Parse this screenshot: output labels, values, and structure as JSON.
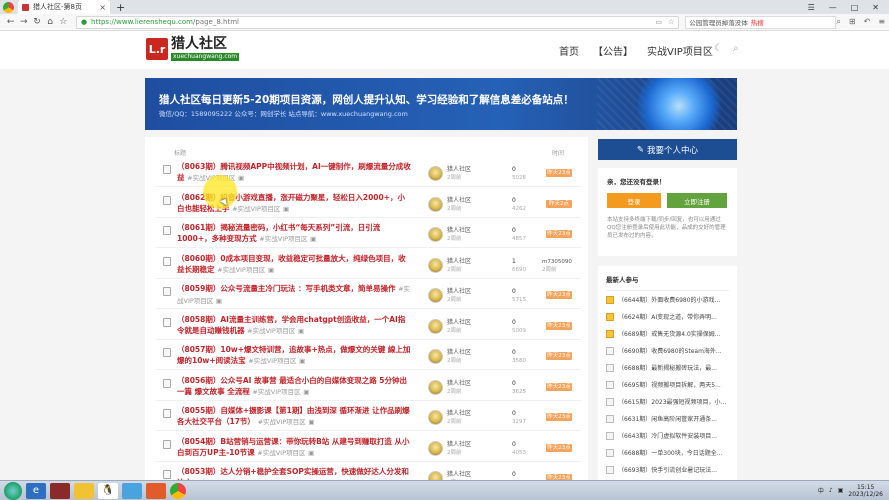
{
  "browser": {
    "tab_title": "猎人社区-第8页",
    "url_host": "https://www.lierenshequ.com",
    "url_path": "/page_8.html",
    "search_text": "公园管理员掉落没体",
    "search_hot": "热搜"
  },
  "site": {
    "logo_badge": "L.r",
    "logo_name": "猎人社区",
    "logo_sub": "xuechuangwang.com",
    "nav": [
      "首页",
      "【公告】",
      "实战VIP项目区"
    ]
  },
  "banner": {
    "title": "猎人社区每日更新5-20期项目资源，网创人提升认知、学习经验和了解信息差必备站点！",
    "subtitle": "微信/QQ：1589095222  公众号：网创学长  站点导航：www.xuechuangwang.com"
  },
  "list": {
    "header_title": "标题",
    "header_time": "时间",
    "items": [
      {
        "title": "（8063期）腾讯视频APP中视频计划，AI一键制作，刷爆流量分成收益",
        "tag": "#实战VIP项目区",
        "author": "猎人社区",
        "author_sub": "2周前",
        "replies": "0",
        "views": "5028",
        "badge": "昨天23点"
      },
      {
        "title": "（8062期）抖音小游戏直播，涨开磁力聚星，轻松日入2000+，小白也能轻松上手",
        "tag": "#实战VIP项目区",
        "author": "猎人社区",
        "author_sub": "2周前",
        "replies": "0",
        "views": "4262",
        "badge": "昨天2点"
      },
      {
        "title": "（8061期）揭秘流量密码，小红书“每天系列”引流，日引流1000+，多种变现方式",
        "tag": "#实战VIP项目区",
        "author": "猎人社区",
        "author_sub": "2周前",
        "replies": "0",
        "views": "4857",
        "badge": "昨天23点"
      },
      {
        "title": "（8060期）0成本项目变现，收益稳定可批量放大，纯绿色项目，收益长期稳定",
        "tag": "#实战VIP项目区",
        "author": "猎人社区",
        "author_sub": "2周前",
        "replies": "1",
        "views": "6690",
        "last_user": "m7305090",
        "last_sub": "2周前"
      },
      {
        "title": "（8059期）公众号流量主冷门玩法 ：写手机类文章，简单易操作",
        "tag": "#实战VIP项目区",
        "author": "猎人社区",
        "author_sub": "2周前",
        "replies": "0",
        "views": "5715",
        "badge": "昨天23点"
      },
      {
        "title": "（8058期）AI流量主训练营，学会用chatgpt创造收益，一个AI指令就是自动赚钱机器",
        "tag": "#实战VIP项目区",
        "author": "猎人社区",
        "author_sub": "2周前",
        "replies": "0",
        "views": "5009",
        "badge": "昨天23点"
      },
      {
        "title": "（8057期）10w+爆文特训营，追故事+热点，做爆文的关键 線上加爆的10w+阅读法宝",
        "tag": "#实战VIP项目区",
        "author": "猎人社区",
        "author_sub": "2周前",
        "replies": "0",
        "views": "3580",
        "badge": "昨天23点"
      },
      {
        "title": "（8056期）公众号AI 故事营 最适合小白的自媒体变现之路 5分钟出一篇 爆文故事 全流程",
        "tag": "#实战VIP项目区",
        "author": "猎人社区",
        "author_sub": "2周前",
        "replies": "0",
        "views": "3625",
        "badge": "昨天23点"
      },
      {
        "title": "（8055期）自媒体+摄影课【第1期】由浅到深 循环渐进 让作品刷爆 各大社交平台（17节）",
        "tag": "#实战VIP项目区",
        "author": "猎人社区",
        "author_sub": "2周前",
        "replies": "0",
        "views": "3297",
        "badge": "昨天23点"
      },
      {
        "title": "（8054期）B站营销与运营课：带你玩转B站 从建号到赚取打造 从小白到百万UP主-10节课",
        "tag": "#实战VIP项目区",
        "author": "猎人社区",
        "author_sub": "2周前",
        "replies": "0",
        "views": "4053",
        "badge": "昨天23点"
      },
      {
        "title": "（8053期）达人分销+稳护全套SOP实操运营，快速做好达人分发和达人",
        "tag": "#实战VIP项目区",
        "author": "猎人社区",
        "author_sub": "2周前",
        "replies": "0",
        "views": "3120",
        "badge": "昨天23点"
      }
    ]
  },
  "sidebar": {
    "user_center": "我要个人中心",
    "welcome": "亲，您还没有登录！",
    "login": "登录",
    "register": "立即注册",
    "note": "本站支持多终端下载/同步/回复，也可以用通过QQ您注册登录后使用此功能，品成的交好的管理员已发布过的内容。",
    "recent_title": "最新人参与",
    "recent": [
      "（6644期）外面收费6980的小游戏...",
      "（6624期）AI变现之道，带你弄明...",
      "（6689期）戒售无货源4.0实操保姆...",
      "（6690期）收费6980的Steam海外...",
      "（6688期）最新揭秘搬砖玩法，最...",
      "（6695期）视频搬项目拆解，两天5...",
      "（6615期）2023最强短视频项目，小...",
      "（6631期）闲鱼高阶闲管家开通条...",
      "（6643期）冷门虚拟软件安装项目...",
      "（6688期）一单300块，今日话题全...",
      "（6693期）快手引流创业暑记玩法..."
    ]
  },
  "taskbar": {
    "time": "15:15",
    "date": "2023/12/26",
    "ime": "中"
  }
}
